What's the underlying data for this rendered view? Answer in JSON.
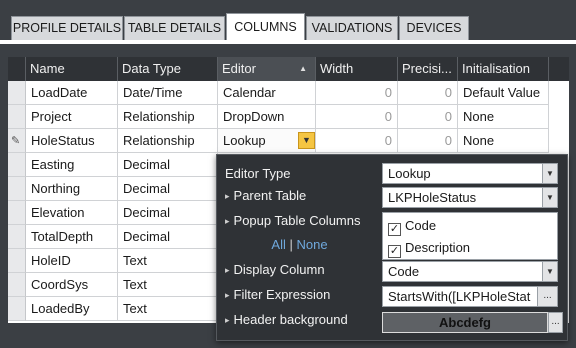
{
  "tabs": [
    {
      "label": "PROFILE DETAILS"
    },
    {
      "label": "TABLE DETAILS"
    },
    {
      "label": "COLUMNS"
    },
    {
      "label": "VALIDATIONS"
    },
    {
      "label": "DEVICES"
    }
  ],
  "grid": {
    "headers": [
      "Name",
      "Data Type",
      "Editor",
      "Width",
      "Precisi...",
      "Initialisation"
    ],
    "rows": [
      {
        "name": "LoadDate",
        "type": "Date/Time",
        "editor": "Calendar",
        "width": "0",
        "precision": "0",
        "init": "Default Value"
      },
      {
        "name": "Project",
        "type": "Relationship",
        "editor": "DropDown",
        "width": "0",
        "precision": "0",
        "init": "None"
      },
      {
        "name": "HoleStatus",
        "type": "Relationship",
        "editor": "Lookup",
        "width": "0",
        "precision": "0",
        "init": "None"
      },
      {
        "name": "Easting",
        "type": "Decimal",
        "editor": "",
        "width": "",
        "precision": "",
        "init": ""
      },
      {
        "name": "Northing",
        "type": "Decimal",
        "editor": "",
        "width": "",
        "precision": "",
        "init": ""
      },
      {
        "name": "Elevation",
        "type": "Decimal",
        "editor": "",
        "width": "",
        "precision": "",
        "init": ""
      },
      {
        "name": "TotalDepth",
        "type": "Decimal",
        "editor": "",
        "width": "",
        "precision": "",
        "init": ""
      },
      {
        "name": "HoleID",
        "type": "Text",
        "editor": "",
        "width": "",
        "precision": "",
        "init": ""
      },
      {
        "name": "CoordSys",
        "type": "Text",
        "editor": "",
        "width": "",
        "precision": "",
        "init": ""
      },
      {
        "name": "LoadedBy",
        "type": "Text",
        "editor": "",
        "width": "",
        "precision": "",
        "init": ""
      }
    ]
  },
  "popup": {
    "editor_type_label": "Editor Type",
    "editor_type_value": "Lookup",
    "parent_table_label": "Parent Table",
    "parent_table_value": "LKPHoleStatus",
    "popup_columns_label": "Popup Table Columns",
    "all_link": "All",
    "separator": "|",
    "none_link": "None",
    "columns": [
      {
        "label": "Code",
        "checked": true
      },
      {
        "label": "Description",
        "checked": true
      }
    ],
    "display_column_label": "Display Column",
    "display_column_value": "Code",
    "filter_expression_label": "Filter Expression",
    "filter_expression_value": "StartsWith([LKPHoleStat",
    "header_background_label": "Header background",
    "header_background_sample": "Abcdefg",
    "ellipsis": "...",
    "check_mark": "✓"
  },
  "colors": {
    "tab_bg": "#d7d9dc",
    "tab_active_bg": "#ffffff",
    "header_bg": "#2f3236",
    "popup_bg": "#2f3236",
    "dropdown_button": "#f5c542",
    "link_color": "#6fa8dc",
    "header_background_swatch": "#5e6165"
  }
}
